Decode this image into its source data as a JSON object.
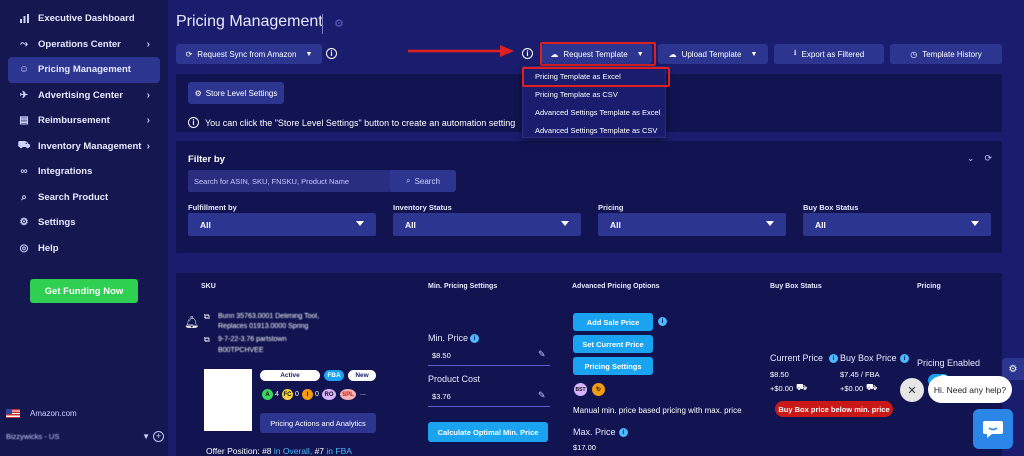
{
  "sidebar": {
    "items": [
      {
        "label": "Executive Dashboard",
        "icon": "bar-chart-icon",
        "glyph": "▮"
      },
      {
        "label": "Operations Center",
        "icon": "routes-icon",
        "glyph": "⤳"
      },
      {
        "label": "Pricing Management",
        "icon": "user-icon",
        "glyph": "☺"
      },
      {
        "label": "Advertising Center",
        "icon": "rocket-icon",
        "glyph": "✈"
      },
      {
        "label": "Reimbursement",
        "icon": "document-icon",
        "glyph": "▤"
      },
      {
        "label": "Inventory Management",
        "icon": "truck-icon",
        "glyph": "⛟"
      },
      {
        "label": "Integrations",
        "icon": "link-icon",
        "glyph": "∞"
      },
      {
        "label": "Search Product",
        "icon": "search-icon",
        "glyph": "⌕"
      },
      {
        "label": "Settings",
        "icon": "gear-icon",
        "glyph": "⚙"
      },
      {
        "label": "Help",
        "icon": "lifebuoy-icon",
        "glyph": "◎"
      }
    ],
    "active_item": "Pricing Management",
    "funding_label": "Get Funding Now",
    "marketplace": "Amazon.com",
    "account": "Bizzywicks - US"
  },
  "header": {
    "title": "Pricing Management",
    "sync_label": "Request Sync from Amazon",
    "request_template_label": "Request Template",
    "upload_template_label": "Upload Template",
    "export_label": "Export as Filtered",
    "history_label": "Template History"
  },
  "template_menu": {
    "items": [
      "Pricing Template as Excel",
      "Pricing Template as CSV",
      "Advanced Settings Template as Excel",
      "Advanced Settings Template as CSV"
    ],
    "highlighted": "Pricing Template as Excel"
  },
  "store": {
    "button_label": "Store Level Settings",
    "note": "You can click the \"Store Level Settings\" button to create an automation setting"
  },
  "filter": {
    "title": "Filter by",
    "search_placeholder": "Search for ASIN, SKU, FNSKU, Product Name",
    "search_button": "Search",
    "fields": [
      {
        "label": "Fulfillment by",
        "value": "All"
      },
      {
        "label": "Inventory Status",
        "value": "All"
      },
      {
        "label": "Pricing",
        "value": "All"
      },
      {
        "label": "Buy Box Status",
        "value": "All"
      }
    ]
  },
  "table": {
    "columns": [
      "SKU",
      "Min. Pricing Settings",
      "Advanced Pricing Options",
      "Buy Box Status",
      "Pricing"
    ],
    "row": {
      "title_line1": "Bunn 35763.0001 Deliming Tool,",
      "title_line2": "Replaces 01913.0000 Spring",
      "sku": "9-7-22-3.76 partstown",
      "asin": "B00TPCHVEE",
      "status_active": "Active",
      "badge_fba": "FBA",
      "badge_new": "New",
      "score_a": "A",
      "score_a_count": "4",
      "score_fc": "FC",
      "score_fc_count": "0",
      "score_i": "I",
      "score_i_count": "0",
      "score_ro": "RO",
      "score_spl": "SPL",
      "ellipsis": "...",
      "analytics_button": "Pricing Actions and Analytics",
      "offer_prefix": "Offer Position:",
      "offer_overall": "#8",
      "offer_overall_label": "in Overall,",
      "offer_fba": "#7",
      "offer_fba_label": "in FBA",
      "min_price_label": "Min. Price",
      "min_price_value": "$8.50",
      "product_cost_label": "Product Cost",
      "product_cost_value": "$3.76",
      "calc_button": "Calculate Optimal Min. Price",
      "add_sale_price": "Add Sale Price",
      "set_current_price": "Set Current Price",
      "pricing_settings": "Pricing Settings",
      "bst_badge": "BST",
      "strategy_badge": "↻",
      "strategy_text": "Manual min. price based pricing with max. price",
      "max_price_label": "Max. Price",
      "max_price_value": "$17.00",
      "current_price_label": "Current Price",
      "current_price_value": "$8.50",
      "current_price_ship": "+$0.00",
      "buybox_price_label": "Buy Box Price",
      "buybox_price_value": "$7.45 / FBA",
      "buybox_price_ship": "+$0.00",
      "buybox_alert": "Buy Box price below min. price",
      "pricing_enabled_label": "Pricing Enabled"
    }
  },
  "chat": {
    "greeting": "Hi. Need any help?",
    "close": "✕"
  },
  "colors": {
    "background": "#1a1d6e",
    "sidebar": "#141750",
    "button": "#2c3590",
    "accent": "#1aa3f0",
    "funding": "#2fcf52",
    "alert": "#c81818",
    "highlight_outline": "#e02020"
  }
}
